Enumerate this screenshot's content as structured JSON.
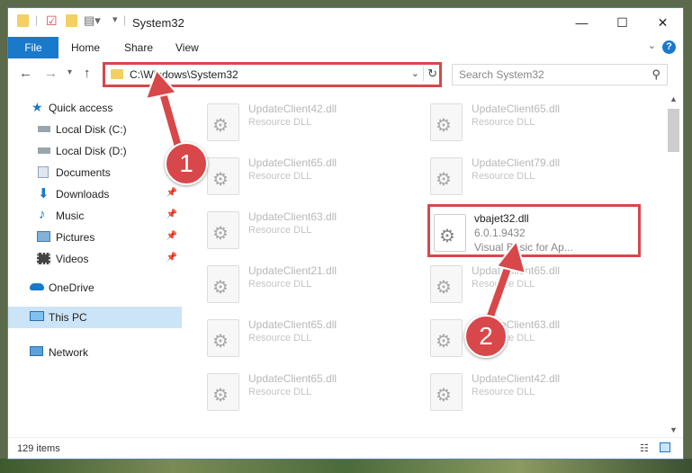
{
  "window": {
    "title": "System32",
    "quick_toolbar": [
      "folder-icon",
      "checkmark-properties-icon",
      "new-folder-icon",
      "customize-icon"
    ],
    "controls": {
      "minimize": "—",
      "maximize": "☐",
      "close": "✕"
    }
  },
  "ribbon": {
    "tabs": [
      "File",
      "Home",
      "Share",
      "View"
    ],
    "help": "?"
  },
  "address": {
    "path": "C:\\Windows\\System32",
    "search_placeholder": "Search System32"
  },
  "sidebar": {
    "items": [
      {
        "label": "Quick access",
        "icon": "star-icon",
        "pinned": false
      },
      {
        "label": "Local Disk (C:)",
        "icon": "drive-icon",
        "pinned": false
      },
      {
        "label": "Local Disk (D:)",
        "icon": "drive-icon",
        "pinned": false
      },
      {
        "label": "Documents",
        "icon": "documents-icon",
        "pinned": true
      },
      {
        "label": "Downloads",
        "icon": "download-icon",
        "pinned": true
      },
      {
        "label": "Music",
        "icon": "music-icon",
        "pinned": true
      },
      {
        "label": "Pictures",
        "icon": "pictures-icon",
        "pinned": true
      },
      {
        "label": "Videos",
        "icon": "videos-icon",
        "pinned": true
      },
      {
        "label": "OneDrive",
        "icon": "cloud-icon",
        "pinned": false
      },
      {
        "label": "This PC",
        "icon": "computer-icon",
        "pinned": false,
        "selected": true
      },
      {
        "label": "Network",
        "icon": "network-icon",
        "pinned": false
      }
    ]
  },
  "files": [
    {
      "name": "UpdateClient42.dll",
      "type": "Resource DLL"
    },
    {
      "name": "UpdateClient65.dll",
      "type": "Resource DLL"
    },
    {
      "name": "UpdateClient65.dll",
      "type": "Resource DLL"
    },
    {
      "name": "UpdateClient79.dll",
      "type": "Resource DLL"
    },
    {
      "name": "UpdateClient63.dll",
      "type": "Resource DLL"
    },
    {
      "name": "vbajet32.dll",
      "type": "6.0.1.9432",
      "desc": "Visual Basic for Ap...",
      "highlighted": true
    },
    {
      "name": "UpdateClient21.dll",
      "type": "Resource DLL"
    },
    {
      "name": "UpdateClient65.dll",
      "type": "Resource DLL"
    },
    {
      "name": "UpdateClient65.dll",
      "type": "Resource DLL"
    },
    {
      "name": "UpdateClient63.dll",
      "type": "Resource DLL"
    },
    {
      "name": "UpdateClient65.dll",
      "type": "Resource DLL"
    },
    {
      "name": "UpdateClient42.dll",
      "type": "Resource DLL"
    }
  ],
  "status": {
    "count": "129 items"
  },
  "annotations": {
    "step1": "1",
    "step2": "2",
    "color": "#d8474a"
  }
}
